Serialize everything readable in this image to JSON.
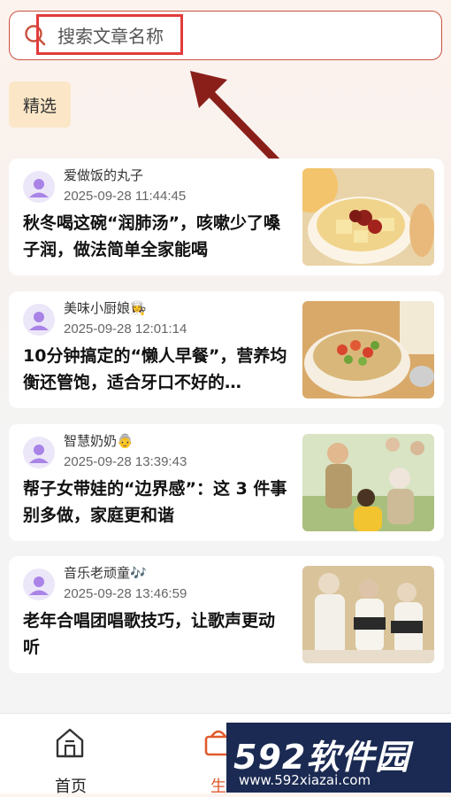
{
  "search": {
    "placeholder": "搜索文章名称"
  },
  "tab": {
    "label": "精选"
  },
  "articles": [
    {
      "author": "爱做饭的丸子",
      "time": "2025-09-28 11:44:45",
      "title": "秋冬喝这碗“润肺汤”，咳嗽少了嗓子润，做法简单全家能喝",
      "thumb": "pear-soup-image"
    },
    {
      "author": "美味小厨娘👩‍🍳",
      "time": "2025-09-28 12:01:14",
      "title": "10分钟搞定的“懒人早餐”，营养均衡还管饱，适合牙口不好的…",
      "thumb": "oatmeal-image"
    },
    {
      "author": "智慧奶奶👵",
      "time": "2025-09-28 13:39:43",
      "title": "帮子女带娃的“边界感”：这 3 件事别多做，家庭更和谐",
      "thumb": "family-image"
    },
    {
      "author": "音乐老顽童🎶",
      "time": "2025-09-28 13:46:59",
      "title": "老年合唱团唱歌技巧，让歌声更动听",
      "thumb": "choir-image"
    }
  ],
  "nav": {
    "home_label": "首页",
    "life_label": "生"
  },
  "watermark": {
    "logo": "592软件园",
    "url": "www.592xiazai.com"
  },
  "colors": {
    "accent": "#c9523f",
    "tag_bg": "#fbe7c7",
    "annotation": "#e23b3b",
    "arrow": "#8a1f1a"
  }
}
